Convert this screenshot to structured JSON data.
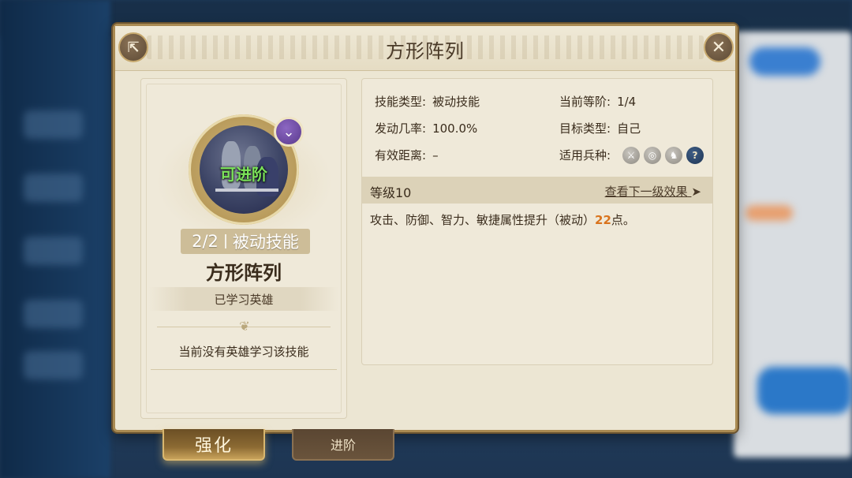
{
  "dialog": {
    "title": "方形阵列"
  },
  "skill_card": {
    "status_label": "可进阶",
    "level_display": "2/2",
    "skill_type_tag": "被动技能",
    "skill_name": "方形阵列",
    "learned_heroes_label": "已学习英雄",
    "no_hero_message": "当前没有英雄学习该技能"
  },
  "details": {
    "skill_type_label": "技能类型:",
    "skill_type_value": "被动技能",
    "current_tier_label": "当前等阶:",
    "current_tier_value": "1/4",
    "trigger_rate_label": "发动几率:",
    "trigger_rate_value": "100.0%",
    "target_type_label": "目标类型:",
    "target_type_value": "自己",
    "range_label": "有效距离:",
    "range_value": "–",
    "troop_types_label": "适用兵种:",
    "troop_icons": [
      "sword-icon",
      "shield-icon",
      "horse-icon",
      "question-icon"
    ],
    "level_label": "等级10",
    "next_level_link": "查看下一级效果",
    "effect_prefix": "攻击、防御、智力、敏捷属性提升（被动）",
    "effect_value": "22",
    "effect_suffix": "点。"
  },
  "tabs": {
    "enhance": "强化",
    "advance": "进阶"
  },
  "colors": {
    "accent_gold": "#c8a25a",
    "effect_number": "#d9731c",
    "advance_green": "#7be35a",
    "badge_purple": "#6b48a4"
  }
}
